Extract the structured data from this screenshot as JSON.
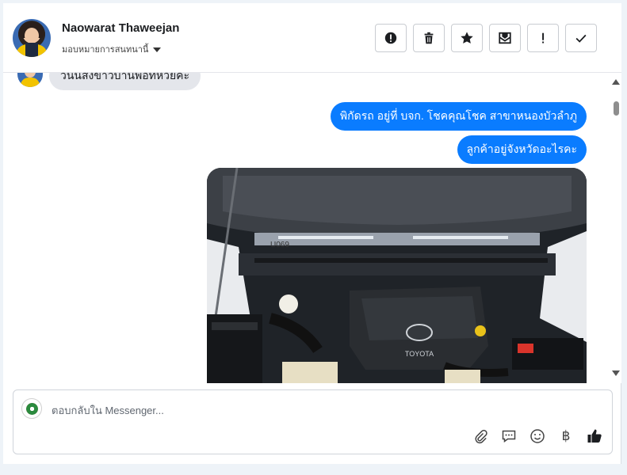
{
  "header": {
    "contact_name": "Naowarat Thaweejan",
    "assign_label": "มอบหมายการสนทนานี้",
    "tools": [
      {
        "icon": "alert-circle-icon"
      },
      {
        "icon": "trash-icon"
      },
      {
        "icon": "star-icon"
      },
      {
        "icon": "archive-icon"
      },
      {
        "icon": "exclamation-icon"
      },
      {
        "icon": "check-icon"
      }
    ]
  },
  "messages": {
    "incoming_partial": "วันนี้ส่งข้าวบ้านพ่อที่ห้วยคะ",
    "outgoing": [
      "พิกัดรถ อยู่ที่ บจก. โชคคุณโชค สาขาหนองบัวลำภู",
      "ลูกค้าอยู่จังหวัดอะไรคะ"
    ],
    "photo": {
      "brand": "TOYOTA",
      "marking": "U069"
    }
  },
  "composer": {
    "placeholder": "ตอบกลับใน Messenger...",
    "actions": [
      "paperclip-icon",
      "saved-reply-icon",
      "emoji-icon",
      "baht-icon",
      "thumbs-up-icon"
    ],
    "baht_symbol": "฿"
  },
  "colors": {
    "outgoing_bubble": "#0a7cff",
    "incoming_bubble": "#e4e6eb"
  }
}
